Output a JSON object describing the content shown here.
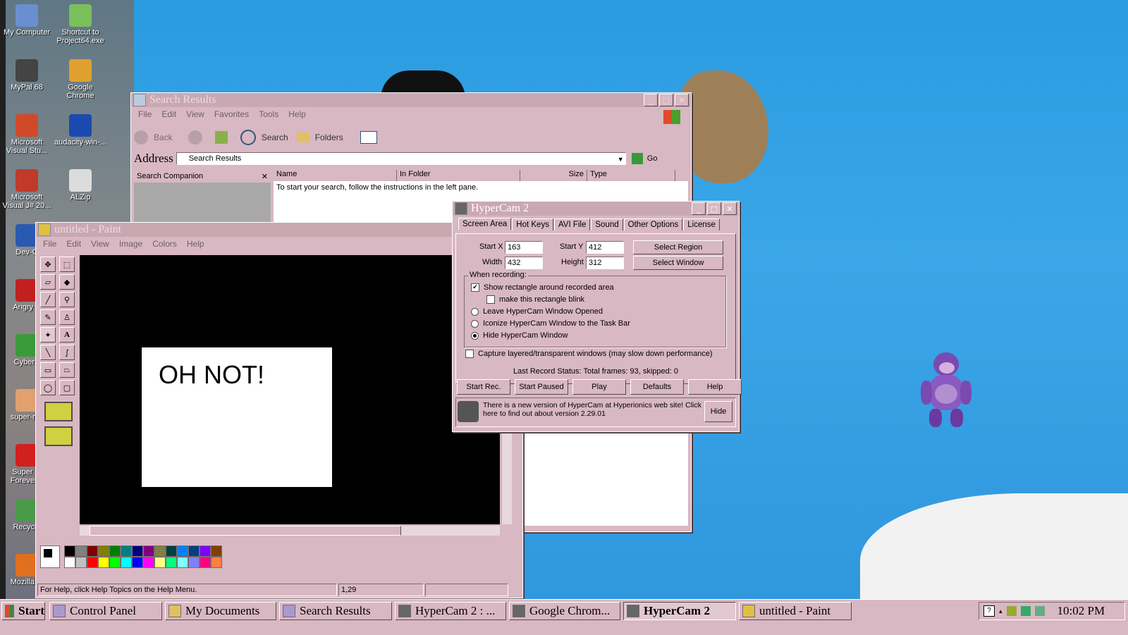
{
  "desktop": {
    "icons": [
      {
        "label": "My Computer",
        "color": "#6a8fd0"
      },
      {
        "label": "Shortcut to Project64.exe",
        "color": "#7bbf5a"
      },
      {
        "label": "MyPal 68",
        "color": "#444"
      },
      {
        "label": "Google Chrome",
        "color": "#e0a030"
      },
      {
        "label": "Microsoft Visual Stu...",
        "color": "#d04a2a"
      },
      {
        "label": "audacity-win-...",
        "color": "#1a4ab0"
      },
      {
        "label": "Microsoft Visual J# 20...",
        "color": "#c03a2a"
      },
      {
        "label": "ALZip",
        "color": "#dcdcdc"
      },
      {
        "label": "Dev-C",
        "color": "#2a5ab0"
      },
      {
        "label": "Angry B",
        "color": "#c02020"
      },
      {
        "label": "CyberB",
        "color": "#3a9a3a"
      },
      {
        "label": "super-ma",
        "color": "#e0a070"
      },
      {
        "label": "Super M Forever v",
        "color": "#d02020"
      },
      {
        "label": "Recycle",
        "color": "#4a9a4a"
      },
      {
        "label": "Mozilla Fi",
        "color": "#e07020"
      }
    ]
  },
  "search_window": {
    "title": "Search Results",
    "menu": [
      "File",
      "Edit",
      "View",
      "Favorites",
      "Tools",
      "Help"
    ],
    "toolbar": {
      "back": "Back",
      "search": "Search",
      "folders": "Folders"
    },
    "address_label": "Address",
    "address_value": "Search Results",
    "go": "Go",
    "companion_title": "Search Companion",
    "columns": [
      "Name",
      "In Folder",
      "Size",
      "Type"
    ],
    "instruction": "To start your search, follow the instructions in the left pane."
  },
  "paint_window": {
    "title": "untitled - Paint",
    "menu": [
      "File",
      "Edit",
      "View",
      "Image",
      "Colors",
      "Help"
    ],
    "canvas_text": "OH NOT!",
    "status_help": "For Help, click Help Topics on the Help Menu.",
    "status_coords": "1,29",
    "palette_top": [
      "#000000",
      "#808080",
      "#800000",
      "#808000",
      "#008000",
      "#008080",
      "#000080",
      "#800080",
      "#808040",
      "#004040",
      "#0080ff",
      "#004080",
      "#8000ff",
      "#804000"
    ],
    "palette_bottom": [
      "#ffffff",
      "#c0c0c0",
      "#ff0000",
      "#ffff00",
      "#00ff00",
      "#00ffff",
      "#0000ff",
      "#ff00ff",
      "#ffff80",
      "#00ff80",
      "#80ffff",
      "#8080ff",
      "#ff0080",
      "#ff8040"
    ]
  },
  "hypercam": {
    "title": "HyperCam 2",
    "tabs": [
      "Screen Area",
      "Hot Keys",
      "AVI File",
      "Sound",
      "Other Options",
      "License"
    ],
    "start_x_label": "Start X",
    "start_x": "163",
    "start_y_label": "Start Y",
    "start_y": "412",
    "width_label": "Width",
    "width": "432",
    "height_label": "Height",
    "height": "312",
    "select_region": "Select Region",
    "select_window": "Select Window",
    "when_recording": "When recording:",
    "opt_show_rect": "Show rectangle around recorded area",
    "opt_blink": "make this rectangle blink",
    "opt_leave": "Leave HyperCam Window Opened",
    "opt_iconize": "Iconize HyperCam Window to the Task Bar",
    "opt_hide": "Hide HyperCam Window",
    "opt_layered": "Capture layered/transparent windows (may slow down performance)",
    "status": "Last Record Status: Total frames: 93, skipped: 0",
    "buttons": [
      "Start Rec.",
      "Start Paused",
      "Play",
      "Defaults",
      "Help"
    ],
    "notice": "There is a new version of HyperCam at Hyperionics web site! Click here to find out about version 2.29.01",
    "hide": "Hide"
  },
  "taskbar": {
    "start": "Start",
    "tasks": [
      "Control Panel",
      "My Documents",
      "Search Results",
      "HyperCam 2 : ...",
      "Google Chrom...",
      "HyperCam 2",
      "untitled - Paint"
    ],
    "clock": "10:02 PM"
  }
}
